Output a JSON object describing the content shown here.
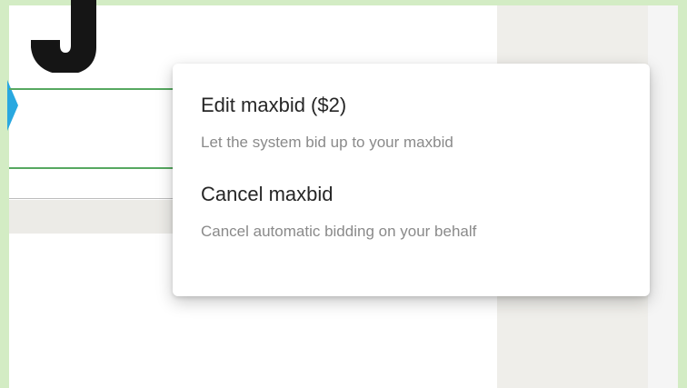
{
  "context_menu": {
    "items": [
      {
        "title": "Edit maxbid ($2)",
        "description": "Let the system bid up to your maxbid"
      },
      {
        "title": "Cancel maxbid",
        "description": "Cancel automatic bidding on your behalf"
      }
    ]
  },
  "colors": {
    "page_background": "#d3ecc4",
    "field_underline": "#56a860",
    "accent_blue": "#29a8e0",
    "menu_title_text": "#262626",
    "menu_description_text": "#8a8a8a"
  },
  "icons": {
    "logo": "logo-icon",
    "accent": "blue-arc-icon"
  }
}
